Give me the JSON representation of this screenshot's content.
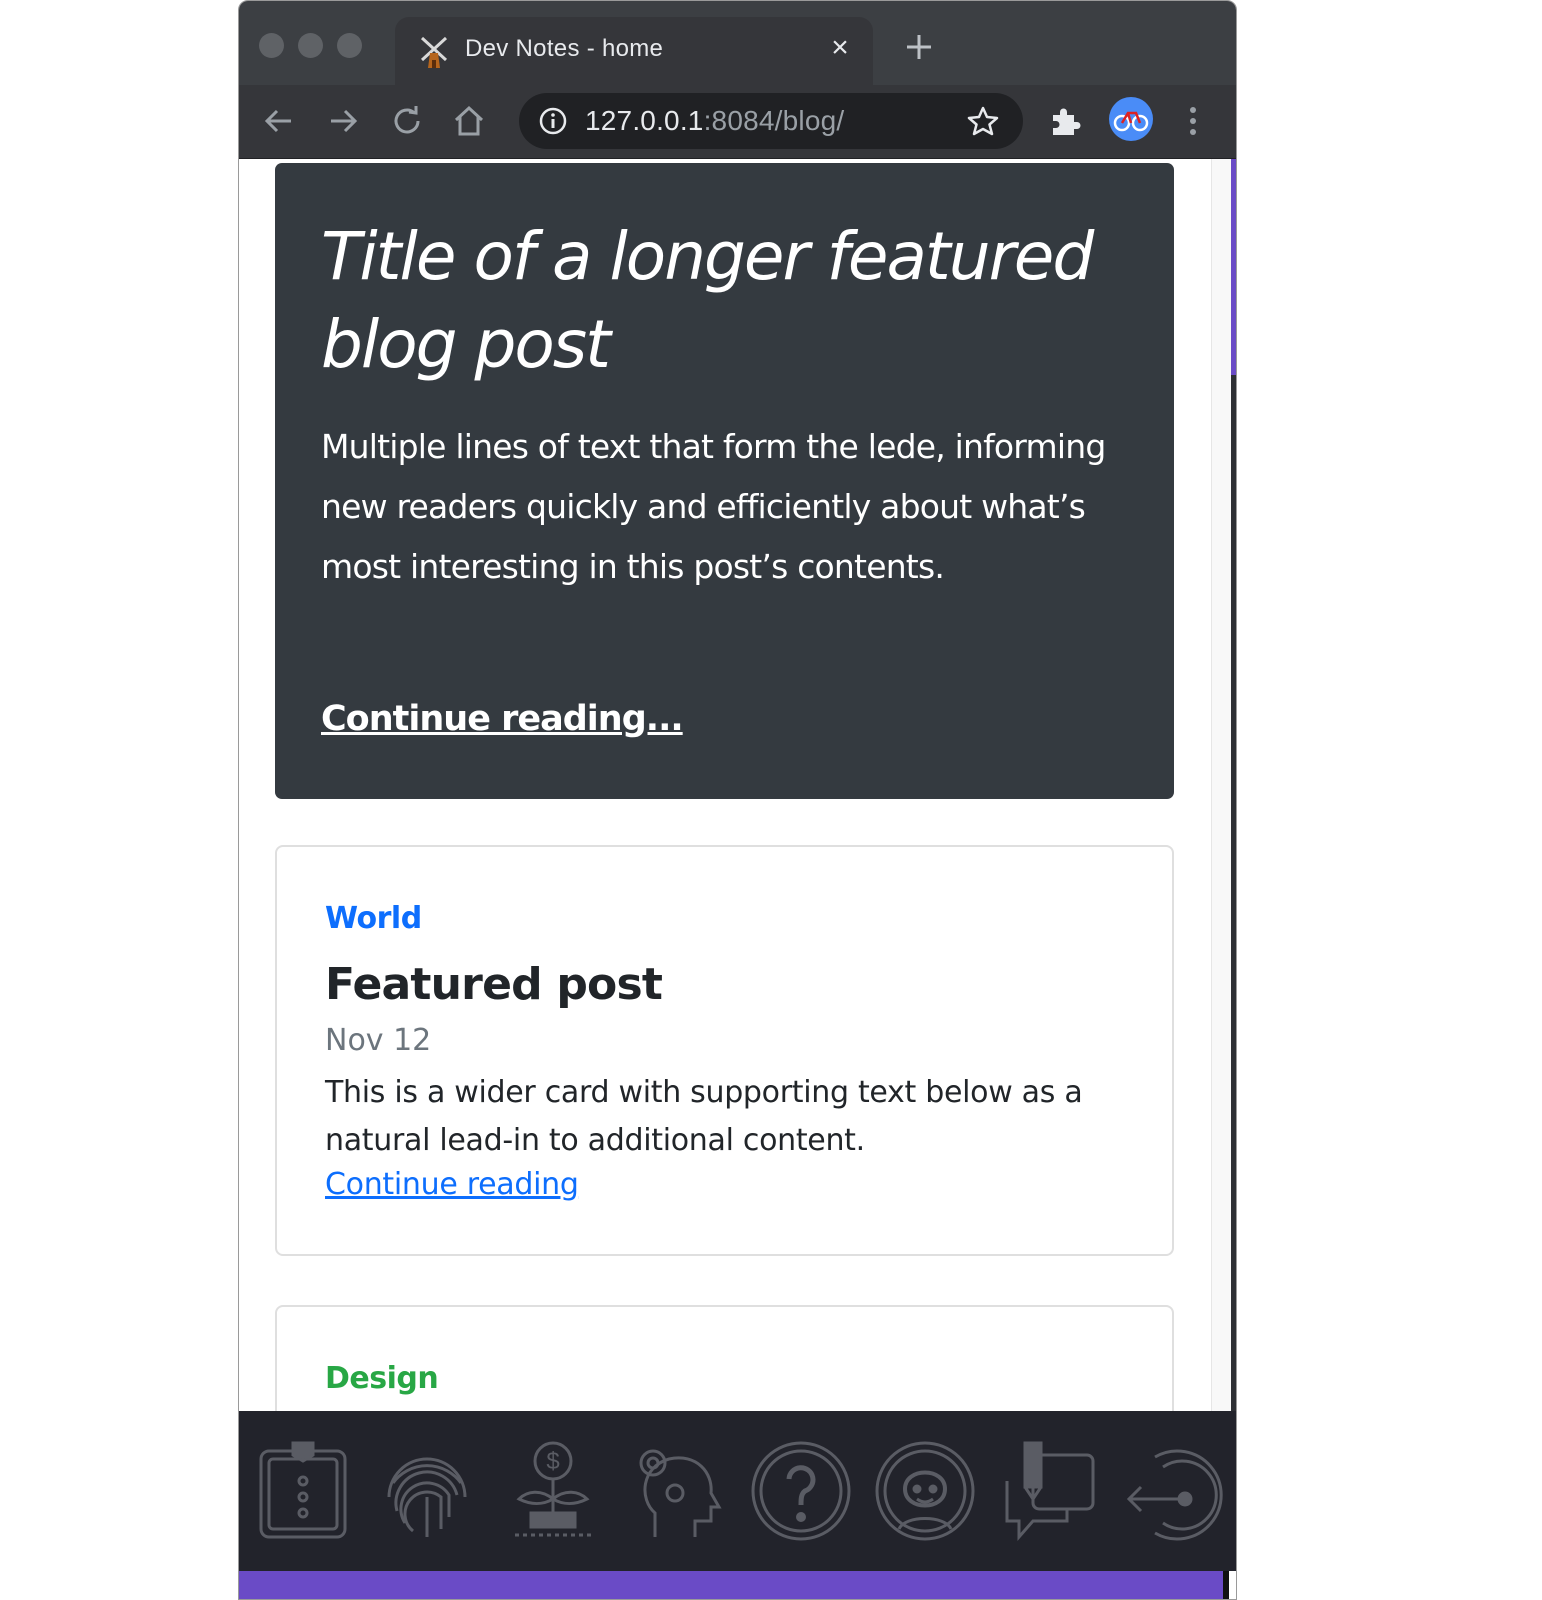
{
  "browser": {
    "tab_title": "Dev Notes - home",
    "url_host": "127.0.0.1",
    "url_rest": ":8084/blog/"
  },
  "hero": {
    "title": "Title of a longer featured blog post",
    "lede": "Multiple lines of text that form the lede, informing new readers quickly and efficiently about what’s most interesting in this post’s contents.",
    "link": "Continue reading..."
  },
  "cards": [
    {
      "category": "World",
      "category_color": "#0d6efd",
      "title": "Featured post",
      "date": "Nov 12",
      "text": "This is a wider card with supporting text below as a natural lead-in to additional content.",
      "link": "Continue reading"
    },
    {
      "category": "Design",
      "category_color": "#28a745"
    }
  ],
  "dock": {
    "icons": [
      "clipboard-icon",
      "fingerprint-icon",
      "money-plant-icon",
      "head-gear-icon",
      "question-icon",
      "face-icon",
      "chat-pen-icon",
      "logout-icon"
    ]
  },
  "colors": {
    "accent": "#6a4bc6",
    "hero_bg": "#343a40",
    "browser_chrome": "#35363a"
  }
}
